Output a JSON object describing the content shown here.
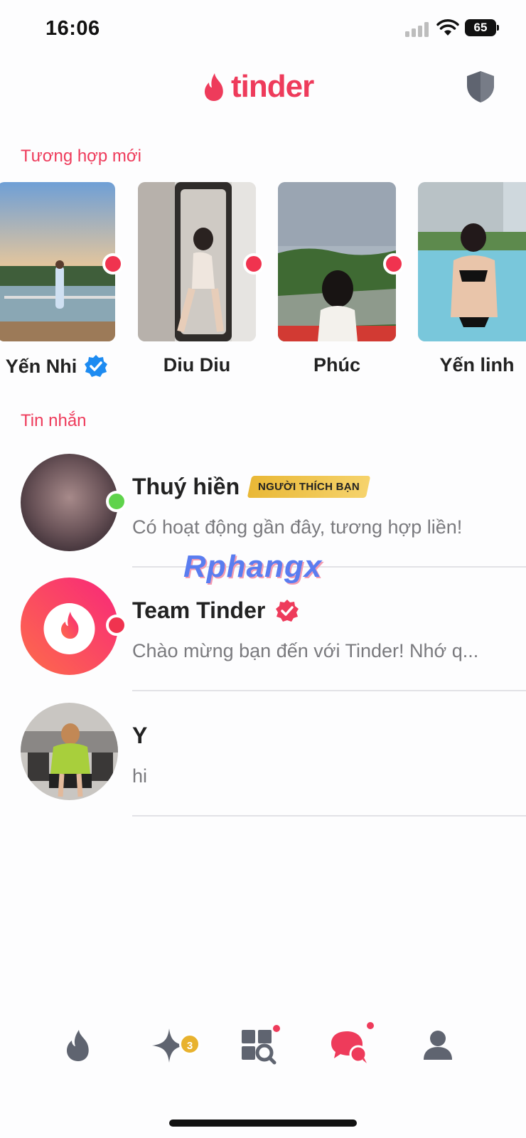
{
  "status_bar": {
    "time": "16:06",
    "battery": "65"
  },
  "header": {
    "logo": "tinder",
    "shield_icon": "shield-icon"
  },
  "new_matches": {
    "title": "Tương hợp mới",
    "items": [
      {
        "name": "Yến Nhi",
        "verified": true
      },
      {
        "name": "Diu Diu",
        "verified": false
      },
      {
        "name": "Phúc",
        "verified": false
      },
      {
        "name": "Yến linh",
        "verified": false
      }
    ]
  },
  "messages": {
    "title": "Tin nhắn",
    "items": [
      {
        "name": "Thuý hiền",
        "badge": "NGƯỜI THÍCH BẠN",
        "preview": "Có hoạt động gần đây, tương hợp liền!",
        "status": "online"
      },
      {
        "name": "Team Tinder",
        "verified": true,
        "preview": "Chào mừng bạn đến với Tinder! Nhớ q...",
        "status": "unread"
      },
      {
        "name": "Y",
        "preview": "hi"
      }
    ]
  },
  "watermark": "Rphangx",
  "bottom_nav": {
    "items": [
      "flame-icon",
      "sparkle-icon",
      "explore-icon",
      "chat-icon",
      "profile-icon"
    ],
    "likes_count": "3"
  },
  "colors": {
    "brand": "#ee3b5b",
    "online": "#5fd34b",
    "gold": "#e8b22e",
    "inactive": "#5f6470"
  }
}
